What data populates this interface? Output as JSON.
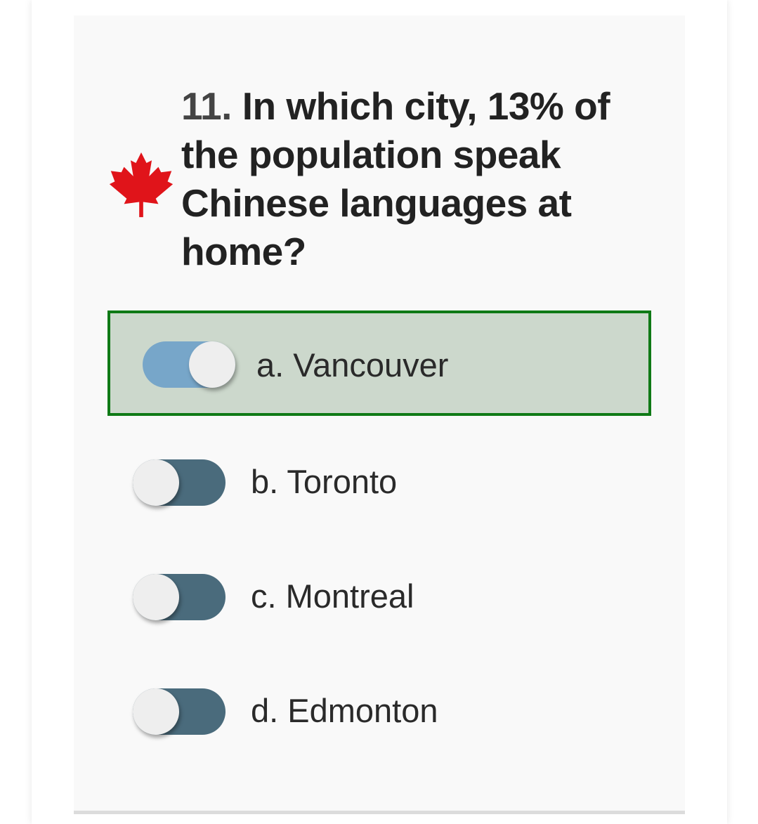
{
  "question": {
    "number": "11.",
    "text": "In which city, 13% of the population speak Chinese languages at home?",
    "flag_icon": "maple-leaf-icon"
  },
  "options": [
    {
      "label": "a. Vancouver",
      "selected": true
    },
    {
      "label": "b. Toronto",
      "selected": false
    },
    {
      "label": "c. Montreal",
      "selected": false
    },
    {
      "label": "d. Edmonton",
      "selected": false
    }
  ],
  "colors": {
    "selected_border": "#0f7a16",
    "selected_background": "#ccd8cc",
    "toggle_on": "#77a6c9",
    "toggle_off": "#4a6b7c",
    "maple_leaf": "#e0141a"
  }
}
